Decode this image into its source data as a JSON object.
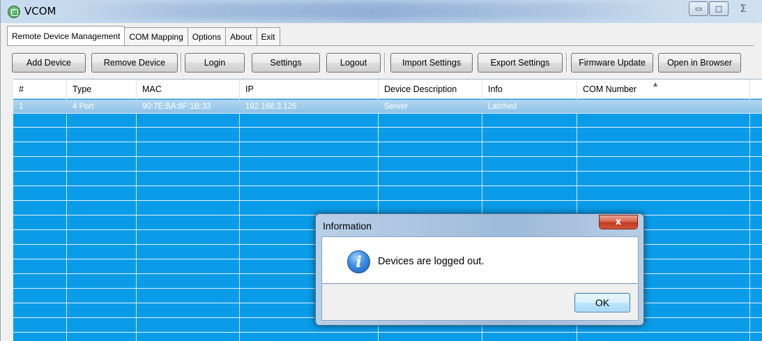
{
  "window": {
    "title": "VCOM",
    "ctrl_minimize": "▭",
    "ctrl_maximize": "□",
    "ctrl_close": "Σ"
  },
  "tabs": [
    {
      "label": "Remote Device Management"
    },
    {
      "label": "COM Mapping"
    },
    {
      "label": "Options"
    },
    {
      "label": "About"
    },
    {
      "label": "Exit"
    }
  ],
  "toolbar": {
    "add_device": "Add Device",
    "remove_device": "Remove Device",
    "login": "Login",
    "settings": "Settings",
    "logout": "Logout",
    "import_settings": "Import Settings",
    "export_settings": "Export Settings",
    "firmware_update": "Firmware Update",
    "open_in_browser": "Open in Browser"
  },
  "table": {
    "columns": [
      "#",
      "Type",
      "MAC",
      "IP",
      "Device Description",
      "Info",
      "COM Number"
    ],
    "rows": [
      [
        "1",
        "4 Port",
        "90:7E:BA:8F:1B:33",
        "192.168.3.125",
        "Server",
        "Latched",
        ""
      ]
    ]
  },
  "dialog": {
    "title": "Information",
    "close_label": "x",
    "message": "Devices are logged out.",
    "ok_label": "OK",
    "icon_glyph": "i"
  },
  "colors": {
    "grid_background": "#0a9ce8",
    "selected_row": "#a9d0ee"
  }
}
